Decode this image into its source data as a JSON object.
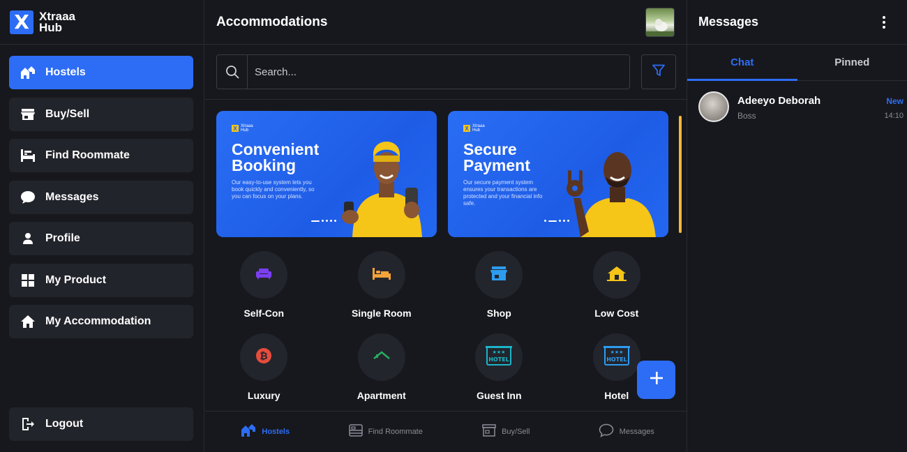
{
  "brand": {
    "logo_letter": "X",
    "line1": "Xtraaa",
    "line2": "Hub"
  },
  "sidebar": {
    "items": [
      {
        "label": "Hostels",
        "icon": "hostels-icon",
        "active": true
      },
      {
        "label": "Buy/Sell",
        "icon": "store-icon"
      },
      {
        "label": "Find Roommate",
        "icon": "bed-icon"
      },
      {
        "label": "Messages",
        "icon": "chat-bubble-icon"
      },
      {
        "label": "Profile",
        "icon": "person-icon"
      },
      {
        "label": "My Product",
        "icon": "grid-icon"
      },
      {
        "label": "My Accommodation",
        "icon": "house-icon"
      }
    ],
    "logout": {
      "label": "Logout",
      "icon": "logout-icon"
    }
  },
  "main": {
    "title": "Accommodations",
    "search": {
      "placeholder": "Search...",
      "value": ""
    },
    "banners": [
      {
        "logo_line1": "Xtraaa",
        "logo_line2": "Hub",
        "title": "Convenient Booking",
        "description": "Our easy-to-use system lets you book quickly and conveniently, so you can focus on your plans."
      },
      {
        "logo_line1": "Xtraaa",
        "logo_line2": "Hub",
        "title": "Secure Payment",
        "description": "Our secure payment system ensures your transactions are protected and your financial info safe."
      }
    ],
    "categories": [
      {
        "label": "Self-Con",
        "icon": "sofa-icon",
        "color": "#7b3ff2"
      },
      {
        "label": "Single Room",
        "icon": "bed-icon",
        "color": "#f2a33a"
      },
      {
        "label": "Shop",
        "icon": "store-icon",
        "color": "#2d9cf0"
      },
      {
        "label": "Low Cost",
        "icon": "house-icon",
        "color": "#f5c518"
      },
      {
        "label": "Luxury",
        "icon": "bitcoin-icon",
        "color": "#e74c3c"
      },
      {
        "label": "Apartment",
        "icon": "roof-icon",
        "color": "#27ae60"
      },
      {
        "label": "Guest Inn",
        "icon": "hotel-sign-icon",
        "color": "#1ab6c8"
      },
      {
        "label": "Hotel",
        "icon": "hotel-sign-icon",
        "color": "#2d9cf0"
      }
    ],
    "hotel_sign_text": "HOTEL",
    "bottom_nav": [
      {
        "label": "Hostels",
        "icon": "hostels-icon",
        "active": true
      },
      {
        "label": "Find Roommate",
        "icon": "bed-icon"
      },
      {
        "label": "Buy/Sell",
        "icon": "store-icon"
      },
      {
        "label": "Messages",
        "icon": "chat-bubble-icon"
      }
    ]
  },
  "messages_panel": {
    "title": "Messages",
    "tabs": [
      {
        "label": "Chat",
        "active": true
      },
      {
        "label": "Pinned"
      }
    ],
    "chats": [
      {
        "name": "Adeeyo Deborah",
        "subtitle": "Boss",
        "badge": "New",
        "time": "14:10"
      }
    ]
  },
  "colors": {
    "accent": "#2d6df6",
    "background": "#17181d",
    "card": "#22242b",
    "banner_peek": "#f5b83a"
  }
}
